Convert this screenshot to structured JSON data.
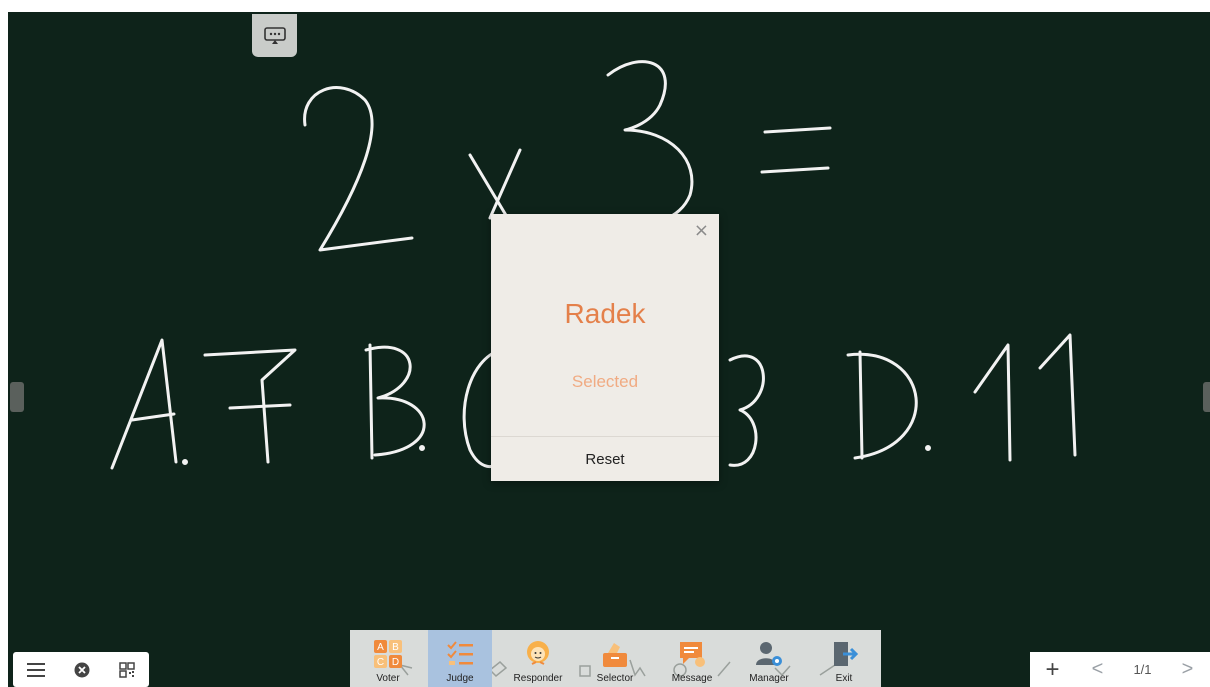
{
  "dialog": {
    "close_label": "×",
    "selected_name": "Radek",
    "status": "Selected",
    "reset_label": "Reset"
  },
  "toolbar": {
    "tools": [
      {
        "label": "Voter",
        "icon": "voter-icon"
      },
      {
        "label": "Judge",
        "icon": "judge-icon"
      },
      {
        "label": "Responder",
        "icon": "responder-icon"
      },
      {
        "label": "Selector",
        "icon": "selector-icon"
      },
      {
        "label": "Message",
        "icon": "message-icon"
      },
      {
        "label": "Manager",
        "icon": "manager-icon"
      },
      {
        "label": "Exit",
        "icon": "exit-icon"
      }
    ]
  },
  "bottom_left": {
    "icons": [
      "menu-icon",
      "close-circle-icon",
      "qr-code-icon"
    ]
  },
  "bottom_right": {
    "add": "+",
    "prev": "<",
    "page_indicator": "1/1",
    "next": ">"
  },
  "colors": {
    "board": "#0e231a",
    "accent": "#e4804a",
    "accent_light": "#f0ab83"
  }
}
